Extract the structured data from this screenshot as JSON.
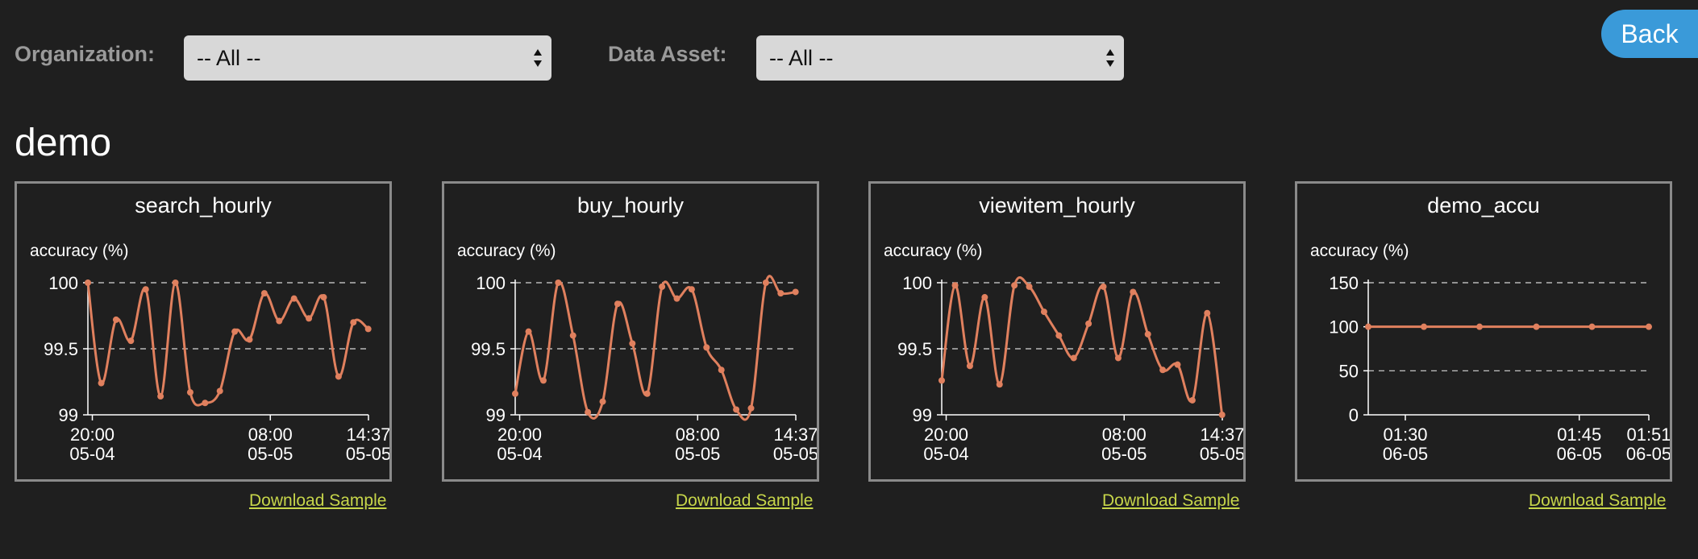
{
  "header": {
    "back_label": "Back",
    "organization_label": "Organization:",
    "organization_value": "-- All --",
    "data_asset_label": "Data Asset:",
    "data_asset_value": "-- All --"
  },
  "group_title": "demo",
  "colors": {
    "line": "#e0805e",
    "link": "#c7d64a",
    "border": "#8a8a8a",
    "back": "#3a9ad9"
  },
  "panels": [
    {
      "title": "search_hourly",
      "y_title": "accuracy (%)",
      "download_label": "Download Sample"
    },
    {
      "title": "buy_hourly",
      "y_title": "accuracy (%)",
      "download_label": "Download Sample"
    },
    {
      "title": "viewitem_hourly",
      "y_title": "accuracy (%)",
      "download_label": "Download Sample"
    },
    {
      "title": "demo_accu",
      "y_title": "accuracy (%)",
      "download_label": "Download Sample"
    }
  ],
  "chart_data": [
    {
      "type": "line",
      "title": "search_hourly",
      "ylabel": "accuracy (%)",
      "ylim": [
        99,
        100
      ],
      "yticks": [
        "99",
        "99.5",
        "100"
      ],
      "xticks": [
        {
          "x": 0.0,
          "label1": "20:00",
          "label2": "05-04"
        },
        {
          "x": 12.0,
          "label1": "08:00",
          "label2": "05-05"
        },
        {
          "x": 18.617,
          "label1": "14:37",
          "label2": "05-05"
        }
      ],
      "xlim": [
        -0.3,
        18.617
      ],
      "grid": "dashed-y",
      "x": [
        -0.3,
        0.6,
        1.6,
        2.6,
        3.6,
        4.6,
        5.6,
        6.6,
        7.6,
        8.6,
        9.6,
        10.6,
        11.6,
        12.6,
        13.6,
        14.6,
        15.6,
        16.6,
        17.6,
        18.6
      ],
      "values": [
        100,
        99.24,
        99.72,
        99.56,
        99.95,
        99.14,
        100,
        99.17,
        99.09,
        99.18,
        99.63,
        99.57,
        99.92,
        99.71,
        99.88,
        99.73,
        99.89,
        99.29,
        99.7,
        99.65
      ]
    },
    {
      "type": "line",
      "title": "buy_hourly",
      "ylabel": "accuracy (%)",
      "ylim": [
        99,
        100
      ],
      "yticks": [
        "99",
        "99.5",
        "100"
      ],
      "xticks": [
        {
          "x": 0.0,
          "label1": "20:00",
          "label2": "05-04"
        },
        {
          "x": 12.0,
          "label1": "08:00",
          "label2": "05-05"
        },
        {
          "x": 18.617,
          "label1": "14:37",
          "label2": "05-05"
        }
      ],
      "xlim": [
        -0.3,
        18.617
      ],
      "grid": "dashed-y",
      "x": [
        -0.3,
        0.6,
        1.6,
        2.6,
        3.6,
        4.6,
        5.6,
        6.6,
        7.6,
        8.6,
        9.6,
        10.6,
        11.6,
        12.6,
        13.6,
        14.6,
        15.6,
        16.6,
        17.6,
        18.6
      ],
      "values": [
        99.16,
        99.63,
        99.26,
        100,
        99.6,
        99.02,
        99.1,
        99.84,
        99.54,
        99.16,
        99.97,
        99.88,
        99.95,
        99.51,
        99.34,
        99.04,
        99.05,
        100,
        99.92,
        99.93
      ]
    },
    {
      "type": "line",
      "title": "viewitem_hourly",
      "ylabel": "accuracy (%)",
      "ylim": [
        99,
        100
      ],
      "yticks": [
        "99",
        "99.5",
        "100"
      ],
      "xticks": [
        {
          "x": 0.0,
          "label1": "20:00",
          "label2": "05-04"
        },
        {
          "x": 12.0,
          "label1": "08:00",
          "label2": "05-05"
        },
        {
          "x": 18.617,
          "label1": "14:37",
          "label2": "05-05"
        }
      ],
      "xlim": [
        -0.3,
        18.617
      ],
      "grid": "dashed-y",
      "x": [
        -0.3,
        0.6,
        1.6,
        2.6,
        3.6,
        4.6,
        5.6,
        6.6,
        7.6,
        8.6,
        9.6,
        10.6,
        11.6,
        12.6,
        13.6,
        14.6,
        15.6,
        16.6,
        17.6,
        18.6
      ],
      "values": [
        99.26,
        99.98,
        99.37,
        99.89,
        99.23,
        99.98,
        99.97,
        99.78,
        99.6,
        99.43,
        99.69,
        99.97,
        99.43,
        99.93,
        99.61,
        99.34,
        99.38,
        99.11,
        99.77,
        99.0
      ]
    },
    {
      "type": "line",
      "title": "demo_accu",
      "ylabel": "accuracy (%)",
      "ylim": [
        0,
        150
      ],
      "yticks": [
        "0",
        "50",
        "100",
        "150"
      ],
      "xticks": [
        {
          "x": 90,
          "label1": "01:30",
          "label2": "06-05"
        },
        {
          "x": 105,
          "label1": "01:45",
          "label2": "06-05"
        },
        {
          "x": 111,
          "label1": "01:51",
          "label2": "06-05"
        }
      ],
      "xlim": [
        86.8,
        111
      ],
      "grid": "dashed-y",
      "x": [
        86.8,
        91.6,
        96.4,
        101.3,
        106.1,
        111
      ],
      "values": [
        100,
        100,
        100,
        100,
        100,
        100
      ]
    }
  ]
}
